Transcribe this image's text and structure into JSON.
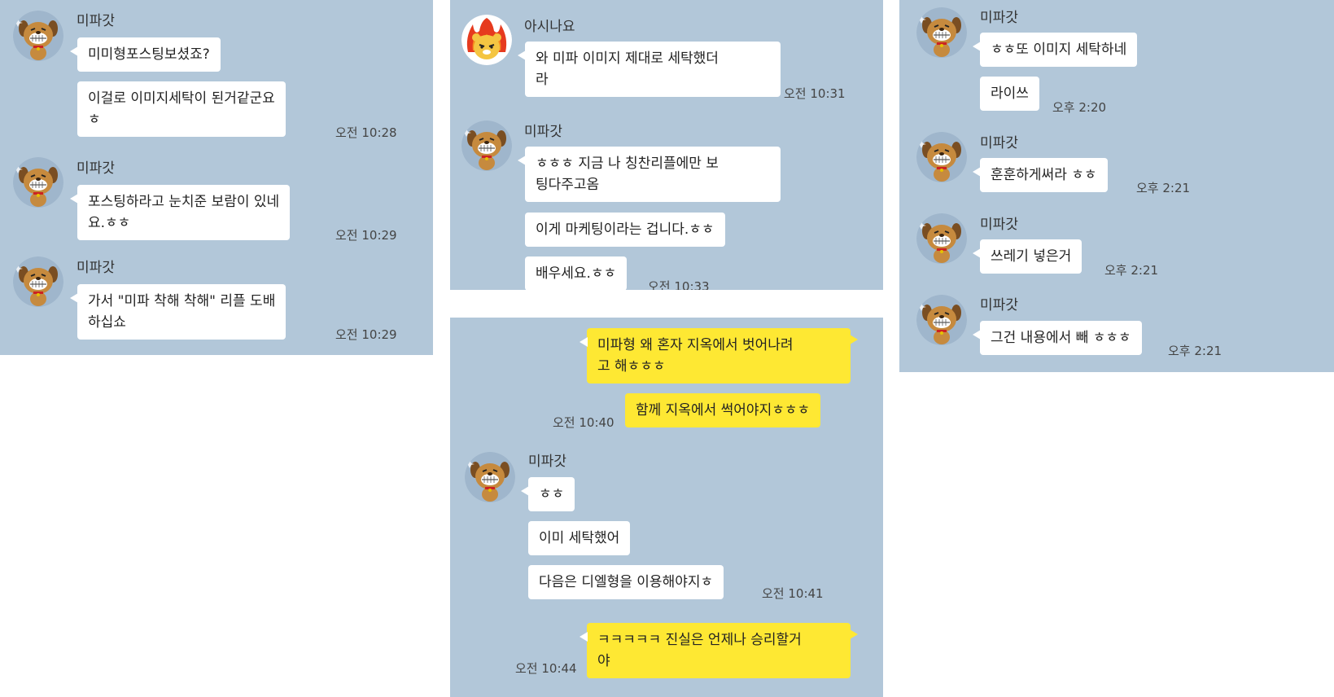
{
  "names": {
    "mipa": "미파갓",
    "asi": "아시나요"
  },
  "panel1": {
    "m1": "미미형포스팅보셨죠?",
    "m2": "이걸로 이미지세탁이 된거같군요\nㅎ",
    "t1": "오전 10:28",
    "m3": "포스팅하라고 눈치준 보람이 있네\n요.ㅎㅎ",
    "t2": "오전 10:29",
    "m4": "가서 \"미파 착해 착해\" 리플 도배\n하십쇼",
    "t3": "오전 10:29"
  },
  "panel2": {
    "m1": "와 미파 이미지 제대로 세탁했더\n라",
    "t1": "오전 10:31",
    "m2": "ㅎㅎㅎ 지금 나 칭찬리플에만 보\n팅다주고옴",
    "m3": "이게 마케팅이라는 겁니다.ㅎㅎ",
    "m4": "배우세요.ㅎㅎ",
    "t2": "오전 10:33"
  },
  "panel3": {
    "me1": "미파형 왜 혼자 지옥에서 벗어나려\n고 해ㅎㅎㅎ",
    "me2": "함께 지옥에서 썩어야지ㅎㅎㅎ",
    "t1": "오전 10:40",
    "m1": "ㅎㅎ",
    "m2": "이미 세탁했어",
    "m3": "다음은 디엘형을 이용해야지ㅎ",
    "t2": "오전 10:41",
    "me3": "ㅋㅋㅋㅋㅋ 진실은 언제나 승리할거\n야",
    "t3": "오전 10:44"
  },
  "panel4": {
    "m1": "ㅎㅎ또 이미지 세탁하네",
    "m2": "라이쓰",
    "t1": "오후 2:20",
    "m3": "훈훈하게써라 ㅎㅎ",
    "t2": "오후 2:21",
    "m4": "쓰레기 넣은거",
    "t3": "오후 2:21",
    "m5": "그건 내용에서 빼 ㅎㅎㅎ",
    "t4": "오후 2:21"
  },
  "colors": {
    "background": "#b2c7d9",
    "my_bubble": "#fee833",
    "other_bubble": "#ffffff"
  },
  "icons": {
    "mipa_avatar": "brown-dog-character-icon",
    "asi_avatar": "yellow-character-with-flames-icon"
  }
}
